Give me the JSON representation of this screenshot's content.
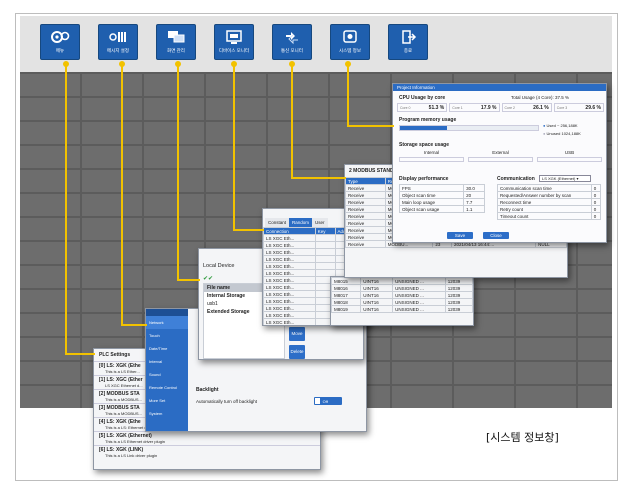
{
  "colors": {
    "accent": "#1f5fae",
    "arrow": "#f2c200",
    "title_bar": "#2b6cc4"
  },
  "toolbar": {
    "buttons": [
      {
        "label": "메뉴",
        "icon": "gears-icon"
      },
      {
        "label": "메시지 설정",
        "icon": "message-settings-icon"
      },
      {
        "label": "화면 관리",
        "icon": "screen-manage-icon"
      },
      {
        "label": "디바이스 모니터",
        "icon": "device-monitor-icon"
      },
      {
        "label": "통신 모니터",
        "icon": "comm-monitor-icon"
      },
      {
        "label": "시스템 정보",
        "icon": "system-info-icon"
      },
      {
        "label": "종료",
        "icon": "exit-icon"
      }
    ]
  },
  "sysinfo": {
    "title": "Project Information",
    "cpu_label": "CPU Usage by core",
    "total_label": "Total Usage (4 Core): 37.5 %",
    "cores": [
      {
        "name": "Core 0",
        "value": "51.3 %"
      },
      {
        "name": "Core 1",
        "value": "17.9 %"
      },
      {
        "name": "Core 2",
        "value": "26.1 %"
      },
      {
        "name": "Core 3",
        "value": "29.6 %"
      }
    ],
    "mem_label": "Program memory usage",
    "mem_used_label": "Used",
    "mem_used_val": "~ 256,188K",
    "mem_free_label": "Unused",
    "mem_free_val": "1024,188K",
    "storage_label": "Storage space usage",
    "storage_cols": [
      "Internal",
      "External",
      "USB"
    ],
    "display_label": "Display performance",
    "display_rows": [
      {
        "k": "FPS",
        "v": "30.0"
      },
      {
        "k": "Object scan time",
        "v": "20"
      },
      {
        "k": "Main loop usage",
        "v": "7.7"
      },
      {
        "k": "Object scan usage",
        "v": "1.1"
      }
    ],
    "comm_label": "Communication",
    "comm_select": "LS XGK (Ethernet)",
    "comm_rows": [
      {
        "k": "Communication scan time",
        "v": "0"
      },
      {
        "k": "Requested/Answer number by scan",
        "v": "0"
      },
      {
        "k": "Reconnect time",
        "v": "0"
      },
      {
        "k": "Retry count",
        "v": "0"
      },
      {
        "k": "Timeout count",
        "v": "0"
      }
    ],
    "ok_label": "Save",
    "close_label": "Close"
  },
  "comm": {
    "title": "2 MODBUS STAND",
    "headers": [
      "Type",
      "Result"
    ],
    "rows": [
      {
        "type": "Receive",
        "result": "MODBU...",
        "id": "23",
        "time": "2021/04/13 16:44:...",
        "v": "NULL"
      },
      {
        "type": "Receive",
        "result": "MODBU...",
        "id": "23",
        "time": "2021/04/13 16:44:...",
        "v": "NULL"
      },
      {
        "type": "Receive",
        "result": "MODBU...",
        "id": "23",
        "time": "2021/04/13 16:44:...",
        "v": "NULL"
      },
      {
        "type": "Receive",
        "result": "MODBU...",
        "id": "23",
        "time": "2021/04/13 16:44:...",
        "v": "NULL"
      },
      {
        "type": "Receive",
        "result": "MODBU...",
        "id": "23",
        "time": "2021/04/13 16:44:...",
        "v": "NULL"
      },
      {
        "type": "Receive",
        "result": "MODBU...",
        "id": "23",
        "time": "2021/04/13 16:44:...",
        "v": "NULL"
      },
      {
        "type": "Receive",
        "result": "MODBU...",
        "id": "23",
        "time": "2021/04/13 16:44:...",
        "v": "NULL"
      },
      {
        "type": "Receive",
        "result": "MODBU...",
        "id": "23",
        "time": "2021/04/13 16:44:...",
        "v": "NULL"
      },
      {
        "type": "Receive",
        "result": "MODBU...",
        "id": "23",
        "time": "2021/04/13 16:44:...",
        "v": "NULL"
      }
    ]
  },
  "device": {
    "tabs": [
      "Constant",
      "Random",
      "User"
    ],
    "headers": [
      "Connection",
      "Key",
      "Address"
    ],
    "rows": [
      {
        "c": "LS XGC Eth...",
        "a": ""
      },
      {
        "c": "LS XGC Eth...",
        "a": ""
      },
      {
        "c": "LS XGC Eth...",
        "a": ""
      },
      {
        "c": "LS XGC Eth...",
        "a": ""
      },
      {
        "c": "LS XGC Eth...",
        "a": ""
      },
      {
        "c": "LS XGC Eth...",
        "a": ""
      },
      {
        "c": "LS XGC Eth...",
        "a": ""
      },
      {
        "c": "LS XGC Eth...",
        "a": ""
      },
      {
        "c": "LS XGC Eth...",
        "a": ""
      },
      {
        "c": "LS XGC Eth...",
        "a": "M8015",
        "t": "UINT16",
        "f": "UNSIGNED ...",
        "v": "12039"
      },
      {
        "c": "LS XGC Eth...",
        "a": "M8016",
        "t": "UINT16",
        "f": "UNSIGNED ...",
        "v": "12039"
      },
      {
        "c": "LS XGC Eth...",
        "a": "M8017",
        "t": "UINT16",
        "f": "UNSIGNED ...",
        "v": "12039"
      },
      {
        "c": "LS XGC Eth...",
        "a": "M8018",
        "t": "UINT16",
        "f": "UNSIGNED ...",
        "v": "12039"
      },
      {
        "c": "LS XGC Eth...",
        "a": "M8019",
        "t": "UINT16",
        "f": "UNSIGNED ...",
        "v": "12039"
      }
    ]
  },
  "storage": {
    "title": "Local Device",
    "items": [
      "File name",
      "Internal Storage",
      "usb1",
      "Extended Storage"
    ],
    "side_buttons": [
      "Move",
      "Delete",
      "Rename"
    ]
  },
  "settings": {
    "tabs": [
      "Network",
      "Touch",
      "Date/Time",
      "Interval",
      "Sound",
      "Remote Control",
      "More Set",
      "System"
    ],
    "backlight_label": "Backlight",
    "backlight_desc": "Automatically turn off backlight",
    "toggle_label": "Off"
  },
  "plc": {
    "title": "PLC Settings",
    "items": [
      {
        "name": "[0] LS: XGK (Ethe",
        "desc": "This is a LS Ether..."
      },
      {
        "name": "[1] LS: XGC (Ether",
        "desc": "LS XGC Ethernet d..."
      },
      {
        "name": "[2] MODBUS STA",
        "desc": "This is a MODBUS..."
      },
      {
        "name": "[3] MODBUS STA",
        "desc": "This is a MODBUS..."
      },
      {
        "name": "[4] LS: XGK (Ethe",
        "desc": "This is a LS: Ethernet driver plugin"
      },
      {
        "name": "[5] LS: XGK (Ethernet)",
        "desc": "This is a LS Ethernet driver plugin"
      },
      {
        "name": "[6] LS: XGK (LINK)",
        "desc": "This is a LS Link driver plugin"
      }
    ]
  },
  "caption": "[시스템 정보창]"
}
